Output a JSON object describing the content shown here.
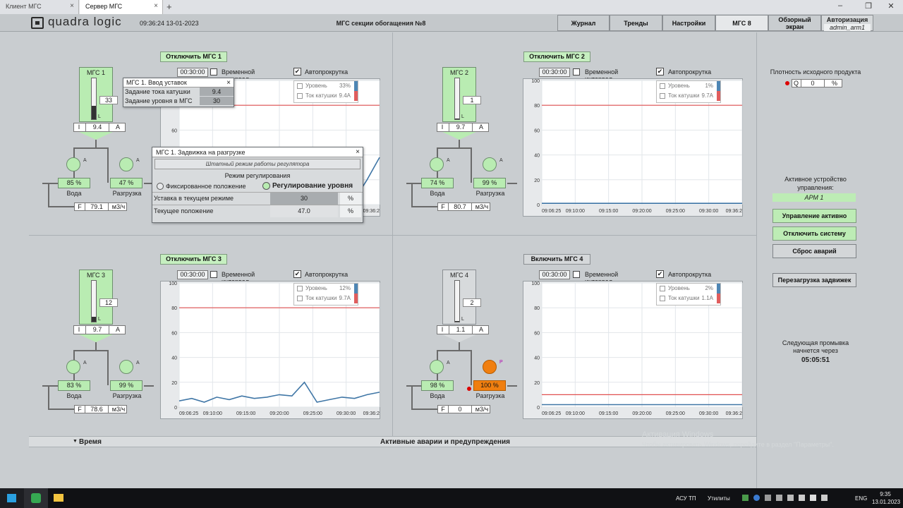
{
  "browser": {
    "tabs": [
      {
        "label": "Клиент МГС",
        "active": false
      },
      {
        "label": "Сервер МГС",
        "active": true
      }
    ],
    "new_tab": "+",
    "close": "×",
    "win_min": "–",
    "win_restore": "❐",
    "win_close": "✕"
  },
  "header": {
    "logo": "quadra logic",
    "clock": "09:36:24 13-01-2023",
    "title": "МГС секции обогащения №8",
    "nav": {
      "journal": "Журнал",
      "trends": "Тренды",
      "settings": "Настройки",
      "mgs8": "МГС 8",
      "overview_l1": "Обзорный",
      "overview_l2": "экран"
    },
    "auth_title": "Авторизация",
    "auth_user": "admin_arm1"
  },
  "common": {
    "flow_f": "F",
    "flow_unit": "м3/ч",
    "coil_i": "I",
    "coil_a": "A",
    "water": "Вода",
    "unload": "Разгрузка",
    "time_interval": "Временной интервал",
    "autoscroll": "Автопрокрутка",
    "legend_level": "Уровень",
    "legend_coil": "Ток катушки",
    "pump_a": "A",
    "pump_p": "P",
    "L": "L",
    "x_ticks": [
      "09:06:25",
      "09:10:00",
      "09:15:00",
      "09:20:00",
      "09:25:00",
      "09:30:00",
      "09:36:2"
    ]
  },
  "units": [
    {
      "toggle_label": "Отключить МГС 1",
      "tank_label": "МГС 1",
      "tank_value": "33",
      "level_fill": 0.33,
      "coil_value": "9.4",
      "water_pct": "85 %",
      "unload_pct": "47 %",
      "flow_value": "79.1",
      "interval": "00:30:00",
      "legend_level": "33%",
      "legend_coil": "9.4A",
      "active": true,
      "unload_on": false
    },
    {
      "toggle_label": "Отключить МГС 2",
      "tank_label": "МГС 2",
      "tank_value": "1",
      "level_fill": 0.01,
      "coil_value": "9.7",
      "water_pct": "74 %",
      "unload_pct": "99 %",
      "flow_value": "80.7",
      "interval": "00:30:00",
      "legend_level": "1%",
      "legend_coil": "9.7A",
      "active": true,
      "unload_on": false
    },
    {
      "toggle_label": "Отключить МГС 3",
      "tank_label": "МГС 3",
      "tank_value": "12",
      "level_fill": 0.12,
      "coil_value": "9.7",
      "water_pct": "83 %",
      "unload_pct": "99 %",
      "flow_value": "78.6",
      "interval": "00:30:00",
      "legend_level": "12%",
      "legend_coil": "9.7A",
      "active": true,
      "unload_on": false
    },
    {
      "toggle_label": "Включить МГС 4",
      "tank_label": "МГС 4",
      "tank_value": "2",
      "level_fill": 0.02,
      "coil_value": "1.1",
      "water_pct": "98 %",
      "unload_pct": "100 %",
      "flow_value": "0",
      "interval": "00:30:00",
      "legend_level": "2%",
      "legend_coil": "1.1A",
      "active": false,
      "unload_on": true
    }
  ],
  "popup_setpoints": {
    "title": "МГС 1. Ввод уставок",
    "rows": [
      {
        "label": "Задание тока катушки",
        "value": "9.4"
      },
      {
        "label": "Задание уровня в МГС",
        "value": "30"
      }
    ]
  },
  "popup_valve": {
    "title": "МГС 1. Задвижка на разгрузке",
    "status": "Штатный режим работы регулятора",
    "mode_title": "Режим регулирования",
    "option_fixed": "Фиксированное положение",
    "option_level": "Регулирование уровня",
    "setpoint_label": "Уставка в текущем режиме",
    "setpoint_value": "30",
    "position_label": "Текущее положение",
    "position_value": "47.0",
    "unit": "%"
  },
  "right_panel": {
    "density_title": "Плотность исходного продукта",
    "density_q": "Q",
    "density_value": "0",
    "density_unit": "%",
    "active_device_l1": "Активное устройство",
    "active_device_l2": "управления:",
    "active_device": "АРМ 1",
    "control_active": "Управление активно",
    "disable_system": "Отключить систему",
    "reset_alarms": "Сброс аварий",
    "restart_valves": "Перезагрузка задвижек",
    "next_flush_l1": "Следующая промывка",
    "next_flush_l2": "начнется через",
    "next_flush_time": "05:05:51"
  },
  "alarms": {
    "time_col": "Время",
    "title": "Активные аварии и предупреждения"
  },
  "watermark": {
    "line1": "Активация Windows",
    "line2": "Чтобы активировать Windows, перейдите в раздел \"Параметры\"."
  },
  "taskbar": {
    "asu": "АСУ ТП",
    "utils": "Утилиты",
    "lang": "ENG",
    "time": "9:35",
    "date": "13.01.2023"
  },
  "chart_data": [
    {
      "type": "line",
      "title": "",
      "xlabel": "",
      "ylabel": "",
      "x": [
        "09:06:25",
        "09:10:00",
        "09:15:00",
        "09:20:00",
        "09:25:00",
        "09:30:00",
        "09:36:2"
      ],
      "ylim": [
        0,
        100
      ],
      "setpoint": 80,
      "series": [
        {
          "name": "Уровень",
          "values": [
            2,
            2,
            2,
            2,
            2,
            2,
            2,
            2,
            2,
            2,
            2,
            2,
            3,
            3,
            4,
            20,
            38
          ]
        }
      ]
    },
    {
      "type": "line",
      "title": "",
      "xlabel": "",
      "ylabel": "",
      "x": [
        "09:06:25",
        "09:10:00",
        "09:15:00",
        "09:20:00",
        "09:25:00",
        "09:30:00",
        "09:36:2"
      ],
      "ylim": [
        0,
        100
      ],
      "setpoint": 80,
      "series": [
        {
          "name": "Уровень",
          "values": [
            1,
            1,
            1,
            1,
            1,
            1,
            1,
            1,
            1,
            1,
            1,
            1,
            1,
            1,
            1,
            1,
            1
          ]
        }
      ]
    },
    {
      "type": "line",
      "title": "",
      "xlabel": "",
      "ylabel": "",
      "x": [
        "09:06:25",
        "09:10:00",
        "09:15:00",
        "09:20:00",
        "09:25:00",
        "09:30:00",
        "09:36:2"
      ],
      "ylim": [
        0,
        100
      ],
      "setpoint": 80,
      "series": [
        {
          "name": "Уровень",
          "values": [
            5,
            7,
            4,
            8,
            6,
            9,
            7,
            8,
            10,
            9,
            20,
            4,
            6,
            8,
            7,
            10,
            12
          ]
        }
      ]
    },
    {
      "type": "line",
      "title": "",
      "xlabel": "",
      "ylabel": "",
      "x": [
        "09:06:25",
        "09:10:00",
        "09:15:00",
        "09:20:00",
        "09:25:00",
        "09:30:00",
        "09:36:2"
      ],
      "ylim": [
        0,
        100
      ],
      "setpoint": 10,
      "series": [
        {
          "name": "Уровень",
          "values": [
            2,
            2,
            2,
            2,
            2,
            2,
            2,
            2,
            2,
            2,
            2,
            2,
            2,
            2,
            2,
            2,
            2
          ]
        }
      ]
    }
  ]
}
